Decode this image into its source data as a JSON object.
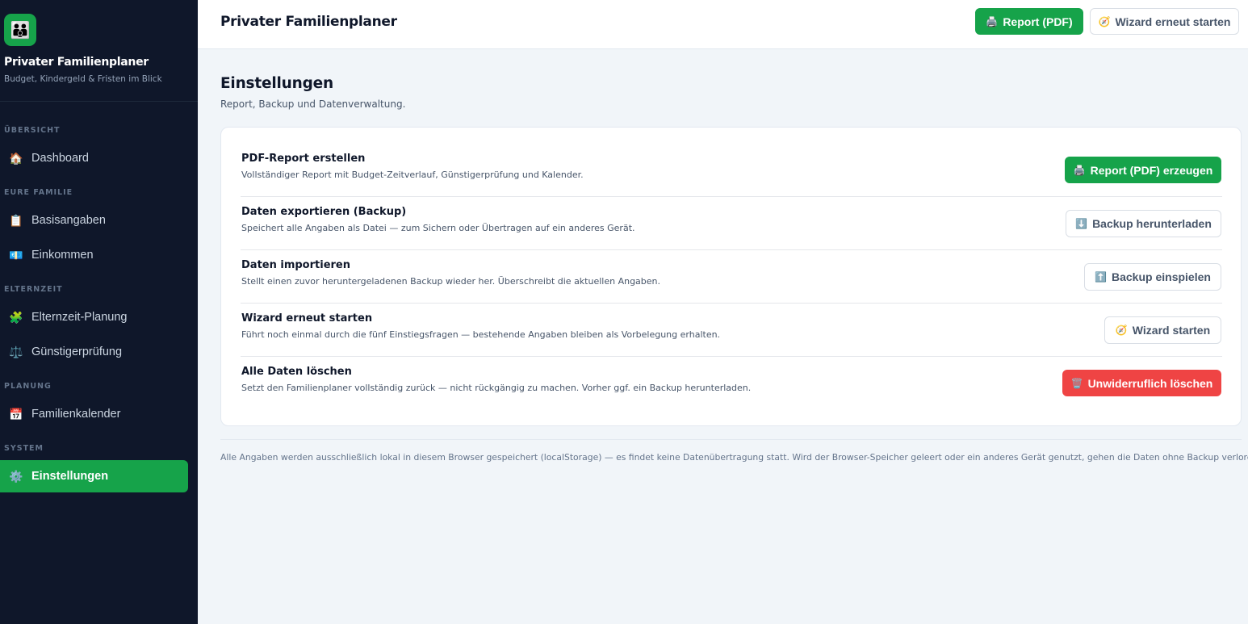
{
  "app": {
    "brand_title": "Privater Familienplaner",
    "brand_subtitle": "Budget, Kindergeld & Fristen im Blick",
    "brand_icon": "family-icon"
  },
  "sidebar": {
    "sections": [
      {
        "label": "ÜBERSICHT"
      },
      {
        "label": "EURE FAMILIE"
      },
      {
        "label": "ELTERNZEIT"
      },
      {
        "label": "PLANUNG"
      },
      {
        "label": "SYSTEM"
      }
    ],
    "items": [
      {
        "label": "Dashboard",
        "icon": "house-icon",
        "glyph": "🏠"
      },
      {
        "label": "Basisangaben",
        "icon": "clipboard-icon",
        "glyph": "📋"
      },
      {
        "label": "Einkommen",
        "icon": "money-icon",
        "glyph": "💶"
      },
      {
        "label": "Elternzeit-Planung",
        "icon": "puzzle-icon",
        "glyph": "🧩"
      },
      {
        "label": "Günstigerprüfung",
        "icon": "scales-icon",
        "glyph": "⚖️"
      },
      {
        "label": "Familienkalender",
        "icon": "calendar-icon",
        "glyph": "📅"
      },
      {
        "label": "Einstellungen",
        "icon": "gear-icon",
        "glyph": "⚙️",
        "active": true
      }
    ]
  },
  "topbar": {
    "title": "Privater Familienplaner",
    "report_button": {
      "label": "Report (PDF)",
      "glyph": "🖨️"
    },
    "wizard_button": {
      "label": "Wizard erneut starten",
      "glyph": "🧭"
    }
  },
  "main": {
    "title": "Einstellungen",
    "subtitle": "Report, Backup und Datenverwaltung.",
    "rows": [
      {
        "title": "PDF-Report erstellen",
        "description": "Vollständiger Report mit Budget-Zeitverlauf, Günstigerprüfung und Kalender.",
        "button": {
          "label": "Report (PDF) erzeugen",
          "glyph": "🖨️",
          "style": "green"
        }
      },
      {
        "title": "Daten exportieren (Backup)",
        "description": "Speichert alle Angaben als Datei — zum Sichern oder Übertragen auf ein anderes Gerät.",
        "button": {
          "label": "Backup herunterladen",
          "glyph": "⬇️",
          "style": "white"
        }
      },
      {
        "title": "Daten importieren",
        "description": "Stellt einen zuvor heruntergeladenen Backup wieder her. Überschreibt die aktuellen Angaben.",
        "button": {
          "label": "Backup einspielen",
          "glyph": "⬆️",
          "style": "white"
        }
      },
      {
        "title": "Wizard erneut starten",
        "description": "Führt noch einmal durch die fünf Einstiegsfragen — bestehende Angaben bleiben als Vorbelegung erhalten.",
        "button": {
          "label": "Wizard starten",
          "glyph": "🧭",
          "style": "white"
        }
      },
      {
        "title": "Alle Daten löschen",
        "description": "Setzt den Familienplaner vollständig zurück — nicht rückgängig zu machen. Vorher ggf. ein Backup herunterladen.",
        "button": {
          "label": "Unwiderruflich löschen",
          "glyph": "🗑️",
          "style": "red"
        }
      }
    ],
    "footer_note": "Alle Angaben werden ausschließlich lokal in diesem Browser gespeichert (localStorage) — es findet keine Datenübertragung statt. Wird der Browser-Speicher geleert oder ein anderes Gerät genutzt, gehen die Daten ohne Backup verloren."
  },
  "colors": {
    "sidebar_bg": "#0f172a",
    "accent_green": "#16a34a",
    "danger_red": "#ef4444",
    "page_bg": "#f1f5f9"
  }
}
